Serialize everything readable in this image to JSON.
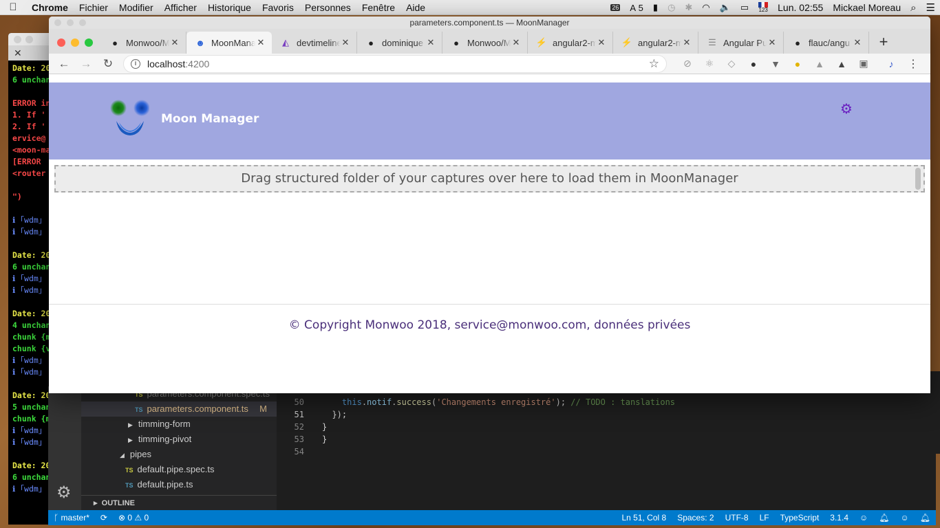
{
  "menubar": {
    "app": "Chrome",
    "items": [
      "Fichier",
      "Modifier",
      "Afficher",
      "Historique",
      "Favoris",
      "Personnes",
      "Fenêtre",
      "Aide"
    ],
    "calendar_badge": "26",
    "adobe_count": "5",
    "input_source": "123",
    "clock": "Lun. 02:55",
    "user": "Mickael Moreau"
  },
  "terminal": {
    "lines": [
      {
        "t": "Date: 20",
        "c": "t-y"
      },
      {
        "t": "6 unchan",
        "c": "t-g"
      },
      {
        "t": "",
        "c": "t-w"
      },
      {
        "t": "ERROR in",
        "c": "t-r"
      },
      {
        "t": "1. If '",
        "c": "t-r"
      },
      {
        "t": "2. If '",
        "c": "t-r"
      },
      {
        "t": "ervice@",
        "c": "t-r"
      },
      {
        "t": "<moon-ma",
        "c": "t-r"
      },
      {
        "t": "[ERROR ",
        "c": "t-r"
      },
      {
        "t": "<router",
        "c": "t-r"
      },
      {
        "t": "",
        "c": "t-w"
      },
      {
        "t": "\")",
        "c": "t-r"
      },
      {
        "t": "",
        "c": "t-w"
      },
      {
        "t": "ℹ ｢wdm｣",
        "c": "t-b"
      },
      {
        "t": "ℹ ｢wdm｣",
        "c": "t-b"
      },
      {
        "t": "",
        "c": "t-w"
      },
      {
        "t": "Date: 20",
        "c": "t-y"
      },
      {
        "t": "6 unchan",
        "c": "t-g"
      },
      {
        "t": "ℹ ｢wdm｣",
        "c": "t-b"
      },
      {
        "t": "ℹ ｢wdm｣",
        "c": "t-b"
      },
      {
        "t": "",
        "c": "t-w"
      },
      {
        "t": "Date: 20",
        "c": "t-y"
      },
      {
        "t": "4 unchan",
        "c": "t-g"
      },
      {
        "t": "chunk {m",
        "c": "t-g"
      },
      {
        "t": "chunk {v",
        "c": "t-g"
      },
      {
        "t": "ℹ ｢wdm｣",
        "c": "t-b"
      },
      {
        "t": "ℹ ｢wdm｣",
        "c": "t-b"
      },
      {
        "t": "",
        "c": "t-w"
      },
      {
        "t": "Date: 20",
        "c": "t-y"
      },
      {
        "t": "5 unchan",
        "c": "t-g"
      },
      {
        "t": "chunk {m",
        "c": "t-g"
      },
      {
        "t": "ℹ ｢wdm｣",
        "c": "t-b"
      },
      {
        "t": "ℹ ｢wdm｣",
        "c": "t-b"
      },
      {
        "t": "",
        "c": "t-w"
      },
      {
        "t": "Date: 20",
        "c": "t-y"
      },
      {
        "t": "6 unchan",
        "c": "t-g"
      },
      {
        "t": "ℹ ｢wdm｣",
        "c": "t-b"
      }
    ]
  },
  "chrome": {
    "window_title": "parameters.component.ts — MoonManager",
    "tabs": [
      {
        "label": "Monwoo/Moo",
        "icon": "github-icon"
      },
      {
        "label": "MoonManager",
        "icon": "moon-icon"
      },
      {
        "label": "devtimeline",
        "icon": "devtimeline-icon"
      },
      {
        "label": "dominique",
        "icon": "github-icon"
      },
      {
        "label": "Monwoo/Moo",
        "icon": "github-icon"
      },
      {
        "label": "angular2-m",
        "icon": "bolt-icon"
      },
      {
        "label": "angular2-m",
        "icon": "bolt-icon"
      },
      {
        "label": "Angular Pu",
        "icon": "doc-icon"
      },
      {
        "label": "flauc/angu",
        "icon": "github-icon"
      }
    ],
    "url_host": "localhost",
    "url_port": ":4200"
  },
  "app": {
    "title": "Moon Manager",
    "dropzone_text": "Drag structured folder of your captures over here to load them in MoonManager",
    "copyright": "© Copyright Monwoo 2018, service@monwoo.com, données privées"
  },
  "vscode": {
    "explorer": [
      {
        "name": "parameters.component.spec.ts",
        "type": "TS",
        "color": "y",
        "indent": 78
      },
      {
        "name": "parameters.component.ts",
        "type": "TS",
        "color": "b",
        "indent": 78,
        "selected": true,
        "badge": "M"
      },
      {
        "name": "timming-form",
        "type": "folder",
        "indent": 68
      },
      {
        "name": "timming-pivot",
        "type": "folder",
        "indent": 68
      },
      {
        "name": "pipes",
        "type": "folder-open",
        "indent": 56
      },
      {
        "name": "default.pipe.spec.ts",
        "type": "TS",
        "color": "y",
        "indent": 64
      },
      {
        "name": "default.pipe.ts",
        "type": "TS",
        "color": "b",
        "indent": 64
      }
    ],
    "outline_label": "OUTLINE",
    "code_lines": [
      {
        "n": "50",
        "code": "    this.notif.success('Changements enregistré'); // TODO : tanslations"
      },
      {
        "n": "51",
        "code": "  });",
        "current": true
      },
      {
        "n": "52",
        "code": "}"
      },
      {
        "n": "53",
        "code": "}"
      },
      {
        "n": "54",
        "code": ""
      }
    ],
    "status": {
      "branch": "master*",
      "errors": "0",
      "warnings": "0",
      "position": "Ln 51, Col 8",
      "spaces": "Spaces: 2",
      "encoding": "UTF-8",
      "eol": "LF",
      "language": "TypeScript",
      "version": "3.1.4"
    }
  },
  "colors": {
    "header_bg": "#a0a7e0",
    "footer_text": "#4a2f7a",
    "settings_icon": "#6a1fc0",
    "vscode_status": "#007acc"
  }
}
